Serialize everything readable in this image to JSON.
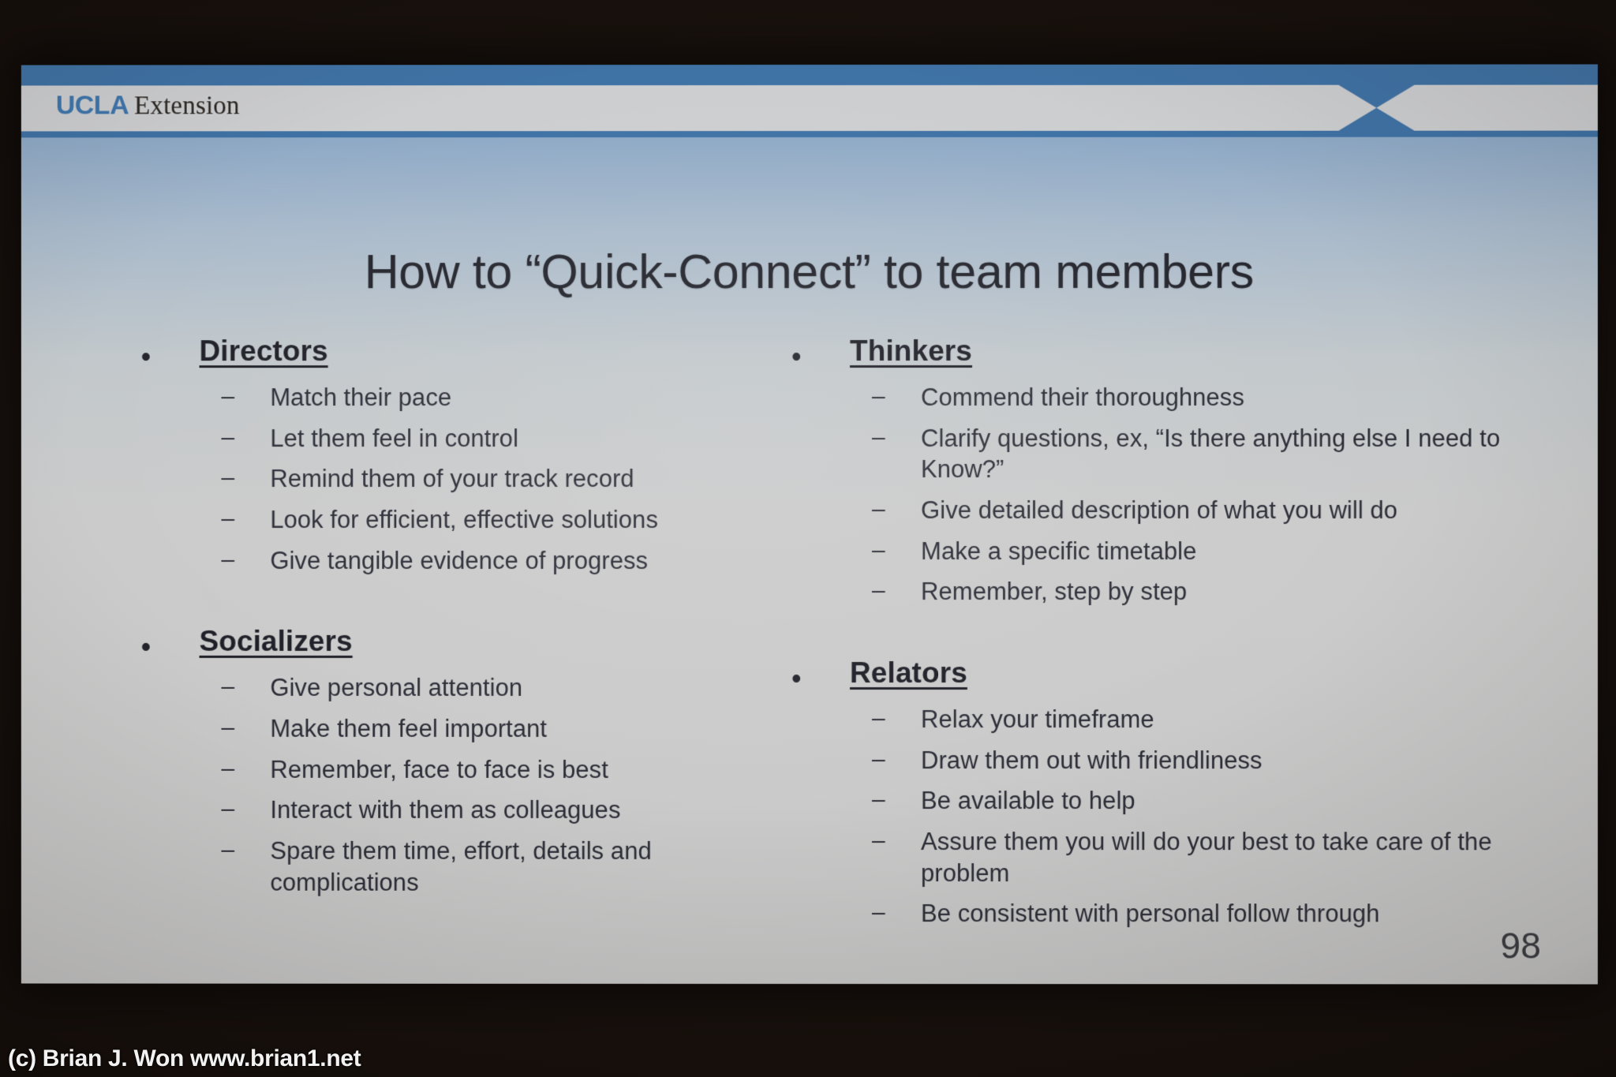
{
  "slide": {
    "logo": {
      "primary": "UCLA",
      "secondary": "Extension"
    },
    "title": "How to “Quick-Connect” to team members",
    "page_number": "98",
    "bullet_glyph": "•",
    "dash_glyph": "–",
    "columns": [
      {
        "side": "left",
        "groups": [
          {
            "title": "Directors",
            "items": [
              "Match their pace",
              "Let them feel in control",
              "Remind them of your track record",
              "Look for efficient, effective solutions",
              "Give tangible evidence of progress"
            ]
          },
          {
            "title": "Socializers",
            "items": [
              "Give personal attention",
              "Make them feel important",
              "Remember, face to face is best",
              "Interact with them as colleagues",
              "Spare them time, effort, details and complications"
            ]
          }
        ]
      },
      {
        "side": "right",
        "groups": [
          {
            "title": "Thinkers",
            "items": [
              "Commend their thoroughness",
              "Clarify questions, ex, “Is there anything else I need to Know?”",
              "Give detailed description of what you will do",
              "Make a specific timetable",
              "Remember, step by step"
            ]
          },
          {
            "title": "Relators",
            "items": [
              "Relax your timeframe",
              "Draw them out with friendliness",
              "Be available to help",
              "Assure them you will do your best  to take care of the problem",
              "Be consistent with personal follow through"
            ]
          }
        ]
      }
    ]
  },
  "watermark": {
    "text": "(c) Brian J. Won www.brian1.net"
  },
  "colors": {
    "header_blue": "#3f72a5",
    "header_gray": "#cdced0",
    "logo_blue": "#3e75ac",
    "body_text": "#2b2c36",
    "slide_background": "#cacaca"
  }
}
